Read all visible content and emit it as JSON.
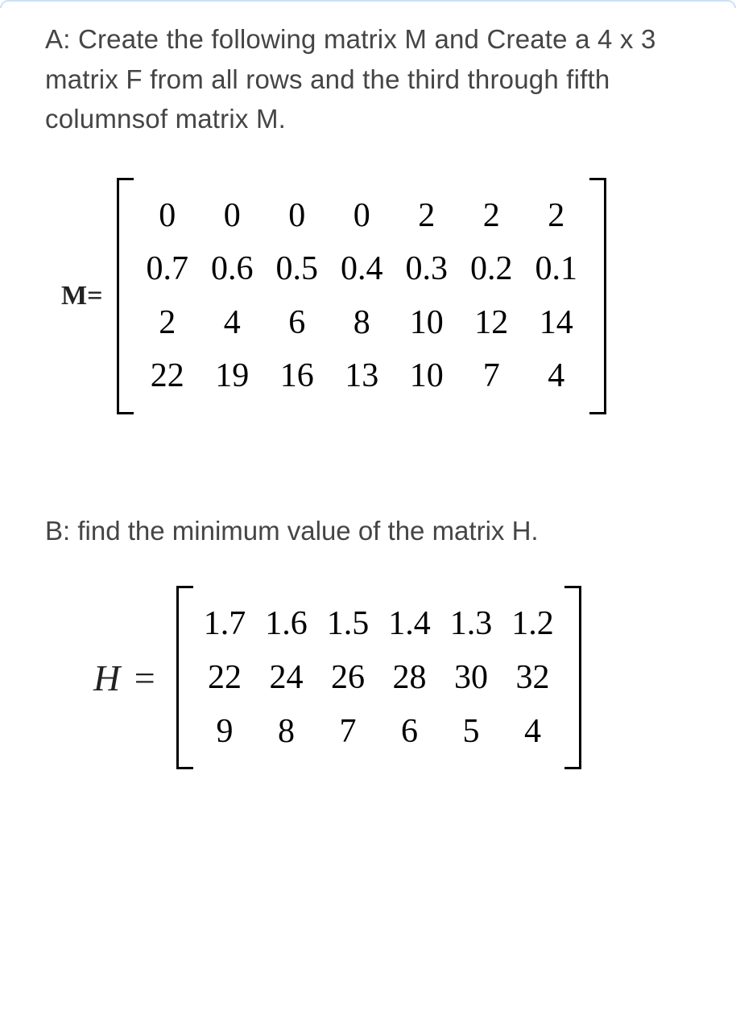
{
  "partA": {
    "prompt": "A: Create the following matrix M and Create a 4 x 3 matrix F from all rows and the third through fifth columnsof matrix M.",
    "label": "M=",
    "matrix": [
      [
        "0",
        "0",
        "0",
        "0",
        "2",
        "2",
        "2"
      ],
      [
        "0.7",
        "0.6",
        "0.5",
        "0.4",
        "0.3",
        "0.2",
        "0.1"
      ],
      [
        "2",
        "4",
        "6",
        "8",
        "10",
        "12",
        "14"
      ],
      [
        "22",
        "19",
        "16",
        "13",
        "10",
        "7",
        "4"
      ]
    ]
  },
  "partB": {
    "prompt": "B: find the minimum value of the matrix H.",
    "label_var": "H",
    "label_eq": "=",
    "matrix": [
      [
        "1.7",
        "1.6",
        "1.5",
        "1.4",
        "1.3",
        "1.2"
      ],
      [
        "22",
        "24",
        "26",
        "28",
        "30",
        "32"
      ],
      [
        "9",
        "8",
        "7",
        "6",
        "5",
        "4"
      ]
    ]
  }
}
